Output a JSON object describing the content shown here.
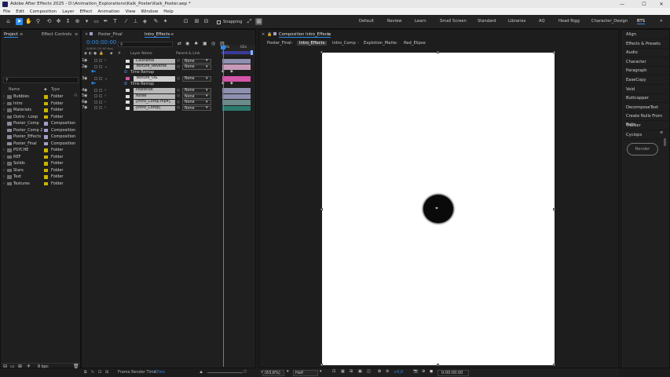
{
  "window": {
    "title": "Adobe After Effects 2025 - D:\\Animation_Explorations\\Kaik_Poster\\Kaik_Poster.aep *",
    "min": "—",
    "max": "☐",
    "close": "✕"
  },
  "menu": [
    "File",
    "Edit",
    "Composition",
    "Layer",
    "Effect",
    "Animation",
    "View",
    "Window",
    "Help"
  ],
  "toolbar": {
    "snapping": "Snapping"
  },
  "workspaces": [
    "Default",
    "Review",
    "Learn",
    "Small Screen",
    "Standard",
    "Libraries",
    "AQ",
    "Head Rigg",
    "Character_Design",
    "BTS"
  ],
  "workspace_more": "»",
  "project": {
    "tab_project": "Project",
    "tab_project_menu": "≡",
    "tab_effects": "Effect Controls Inl",
    "tab_effects_menu": "≡",
    "search_placeholder": "",
    "col_name": "Name",
    "col_type": "Type",
    "items": [
      {
        "name": "Bubbles",
        "type": "Folder",
        "kind": "folder"
      },
      {
        "name": "Intro",
        "type": "Folder",
        "kind": "folder"
      },
      {
        "name": "Materials",
        "type": "Folder",
        "kind": "folder"
      },
      {
        "name": "Outro - Loop",
        "type": "Folder",
        "kind": "folder"
      },
      {
        "name": "Poster_Comp",
        "type": "Composition",
        "kind": "comp"
      },
      {
        "name": "Poster_Comp 2",
        "type": "Composition",
        "kind": "comp"
      },
      {
        "name": "Poster_Effects",
        "type": "Composition",
        "kind": "comp"
      },
      {
        "name": "Poster_Final",
        "type": "Composition",
        "kind": "comp"
      },
      {
        "name": "PSYCHE",
        "type": "Folder",
        "kind": "folder"
      },
      {
        "name": "REF",
        "type": "Folder",
        "kind": "folder"
      },
      {
        "name": "Solids",
        "type": "Folder",
        "kind": "folder"
      },
      {
        "name": "Stars",
        "type": "Folder",
        "kind": "folder"
      },
      {
        "name": "Text",
        "type": "Folder",
        "kind": "folder"
      },
      {
        "name": "Textures",
        "type": "Folder",
        "kind": "folder"
      }
    ],
    "bpc": "8 bpc"
  },
  "timeline": {
    "tabs": [
      "Poster_Final",
      "Intro_Effects"
    ],
    "tab_menu": "≡",
    "timecode": "0:00:00:00",
    "timecode_sub": "00000 (24.00 fps)",
    "col_layer_name": "Layer Name",
    "col_parent": "Parent & Link",
    "ruler": [
      "00s",
      "02s"
    ],
    "layers": [
      {
        "num": "1",
        "name": "Colorama",
        "parent": "None",
        "label": "#c8c8c8",
        "bar": "#8f8fb0"
      },
      {
        "num": "2",
        "name": "Texture_Reverse",
        "parent": "None",
        "label": "#d9a7c8",
        "bar": "#c79ab8"
      },
      {
        "num": "3",
        "name": "Texture_OG",
        "parent": "None",
        "label": "#d9a7c8",
        "bar": "#d356a8"
      },
      {
        "num": "4",
        "name": "Posterize",
        "parent": "None",
        "label": "#c8c8c8",
        "bar": "#8f8fb0"
      },
      {
        "num": "5",
        "name": "Noise",
        "parent": "None",
        "label": "#c8c8c8",
        "bar": "#8f8fb0"
      },
      {
        "num": "6",
        "name": "[Intro_Comp.mp4]",
        "parent": "None",
        "label": "#8fb3b3",
        "bar": "#6b8a8a"
      },
      {
        "num": "7",
        "name": "[Intro_Comp]",
        "parent": "None",
        "label": "#d4c8a0",
        "bar": "#2d7a6e"
      }
    ],
    "time_remap": "Time Remap",
    "frame_render_label": "Frame Render Time:",
    "frame_render_value": "17ms"
  },
  "composition": {
    "title": "Composition Intro_Effects",
    "title_menu": "≡",
    "flow": [
      "Poster_Final",
      "Intro_Comp",
      "Intro_Comp",
      "Explotion_Matte",
      "Red_Elipse"
    ],
    "active_flow": "Intro_Effects",
    "zoom": "(63,6%)",
    "resolution": "Half",
    "exposure": "+0,0",
    "timecode": "0:00:00:00"
  },
  "right_panels": [
    "Align",
    "Effects & Presets",
    "Audio",
    "Character",
    "Paragraph",
    "EaseCopy",
    "Void",
    "Buttcapper",
    "DecomposeText",
    "Create Nulls From Path",
    "Tracker",
    "Cyclops"
  ],
  "cyclops": {
    "render": "Render",
    "menu": "≡"
  },
  "colors": {
    "accent": "#2d8ceb",
    "folder": "#c8b400",
    "comp": "#a89cc8"
  }
}
